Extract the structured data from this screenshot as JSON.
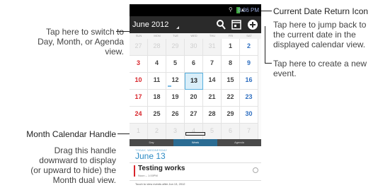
{
  "annotations": {
    "switch_view": {
      "lines": [
        "Tap here to switch to",
        "Day, Month, or Agenda",
        "view."
      ]
    },
    "current_date_return": {
      "title": "Current Date Return Icon",
      "lines": [
        "Tap here to jump back to",
        "the current date in the",
        "displayed calendar view."
      ]
    },
    "create_event": {
      "lines": [
        "Tap here to create a new",
        "event."
      ]
    },
    "month_handle": {
      "title": "Month Calendar Handle",
      "lines": [
        "Drag this handle",
        "downward to display",
        "(or upward to hide) the",
        "Month dual view."
      ]
    }
  },
  "phone": {
    "status": {
      "time": "8:36 PM"
    },
    "actionbar": {
      "month_label": "June 2012"
    },
    "day_headers": [
      "SUN",
      "MON",
      "TUE",
      "WED",
      "THU",
      "FRI",
      "SAT"
    ],
    "weeks": [
      [
        "27",
        "28",
        "29",
        "30",
        "31",
        "1",
        "2"
      ],
      [
        "3",
        "4",
        "5",
        "6",
        "7",
        "8",
        "9"
      ],
      [
        "10",
        "11",
        "12",
        "13",
        "14",
        "15",
        "16"
      ],
      [
        "17",
        "18",
        "19",
        "20",
        "21",
        "22",
        "23"
      ],
      [
        "24",
        "25",
        "26",
        "27",
        "28",
        "29",
        "30"
      ],
      [
        "1",
        "2",
        "3",
        "4",
        "5",
        "6",
        "7"
      ]
    ],
    "tabs": [
      "Day",
      "Week",
      "Agenda"
    ],
    "selected_tab": "Week",
    "agenda": {
      "subheader": "TODAY, WEDNESDAY",
      "date": "June 13",
      "event_title": "Testing works",
      "event_time": "Noon – 1:00PM",
      "footer": "Touch to view events after Jun 13, 2012"
    }
  },
  "colors": {
    "accent": "#2a8ac4",
    "sunday": "#d8262c",
    "saturday": "#2f6fc0",
    "today_bg": "#d9eef9"
  }
}
